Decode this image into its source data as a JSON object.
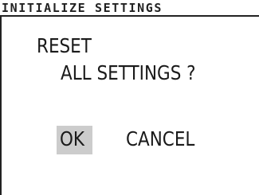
{
  "dialog": {
    "title": "INITIALIZE SETTINGS",
    "message_line1": "RESET",
    "message_line2": "ALL SETTINGS ?"
  },
  "buttons": {
    "ok_label": "OK",
    "cancel_label": "CANCEL",
    "selected": "OK"
  },
  "colors": {
    "selection_highlight": "#cccccc",
    "text": "#1a1a1a",
    "border": "#222222",
    "background": "#ffffff"
  }
}
